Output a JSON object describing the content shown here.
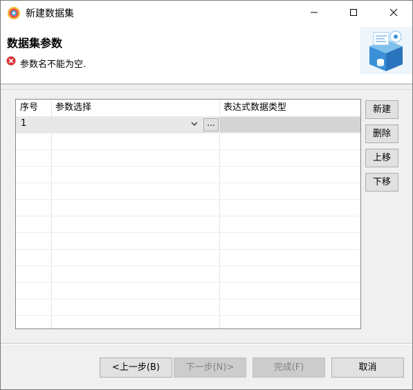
{
  "window": {
    "title": "新建数据集",
    "controls": {
      "minimize_icon": "minimize-icon",
      "maximize_icon": "maximize-icon",
      "close_icon": "close-icon"
    }
  },
  "header": {
    "title": "数据集参数",
    "error_message": "参数名不能为空.",
    "error_icon": "error-icon",
    "banner_icon": "dataset-box-icon"
  },
  "table": {
    "columns": [
      "序号",
      "参数选择",
      "表达式数据类型"
    ],
    "rows": [
      {
        "index": "1",
        "param": "",
        "type": ""
      }
    ],
    "ellipsis_label": "..."
  },
  "side_buttons": {
    "new": "新建",
    "delete": "删除",
    "move_up": "上移",
    "move_down": "下移"
  },
  "footer": {
    "prev": "<上一步(B)",
    "next": "下一步(N)>",
    "finish": "完成(F)",
    "cancel": "取消"
  },
  "colors": {
    "accent_blue": "#3a8fd9",
    "error_red": "#d9383a"
  }
}
